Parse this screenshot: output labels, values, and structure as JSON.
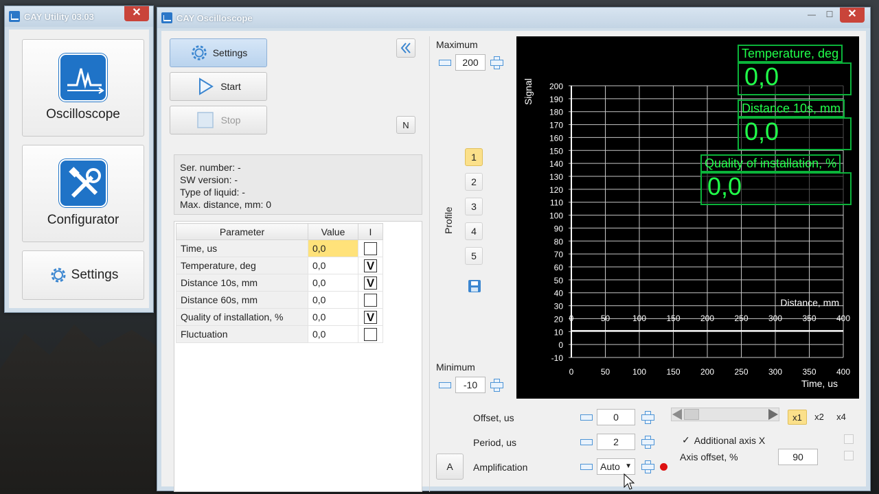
{
  "util_window": {
    "title": "CAY Utility 03.03",
    "close": "✕",
    "buttons": [
      {
        "label": "Oscilloscope",
        "icon": "oscilloscope-icon"
      },
      {
        "label": "Configurator",
        "icon": "tools-icon"
      },
      {
        "label": "Settings",
        "icon": "gear-icon"
      }
    ]
  },
  "osc_window": {
    "title": "CAY Oscilloscope",
    "controls": {
      "minimize": "—",
      "maximize": "☐",
      "close": "✕"
    },
    "settings_label": "Settings",
    "start_label": "Start",
    "stop_label": "Stop",
    "n_label": "N",
    "info": {
      "serial": "Ser. number: -",
      "sw": "SW version: -",
      "liquid": "Type of liquid: -",
      "maxdist": "Max. distance, mm: 0"
    },
    "table": {
      "headers": [
        "Parameter",
        "Value",
        "I"
      ],
      "rows": [
        {
          "name": "Time, us",
          "value": "0,0",
          "checked": false
        },
        {
          "name": "Temperature, deg",
          "value": "0,0",
          "checked": true
        },
        {
          "name": "Distance 10s, mm",
          "value": "0,0",
          "checked": true
        },
        {
          "name": "Distance 60s, mm",
          "value": "0,0",
          "checked": false
        },
        {
          "name": "Quality of installation, %",
          "value": "0,0",
          "checked": true
        },
        {
          "name": "Fluctuation",
          "value": "0,0",
          "checked": false
        }
      ],
      "check_mark": "V"
    },
    "maximum": {
      "label": "Maximum",
      "value": "200"
    },
    "minimum": {
      "label": "Minimum",
      "value": "-10"
    },
    "profile": {
      "label": "Profile",
      "items": [
        "1",
        "2",
        "3",
        "4",
        "5"
      ],
      "active": "1"
    },
    "scope": {
      "y_axis_label": "Signal",
      "y_ticks": [
        200,
        190,
        180,
        170,
        160,
        150,
        140,
        130,
        120,
        110,
        100,
        90,
        80,
        70,
        60,
        50,
        40,
        30,
        20,
        10,
        0,
        -10
      ],
      "x_ticks": [
        0,
        50,
        100,
        150,
        200,
        250,
        300,
        350,
        400
      ],
      "x_label": "Time, us",
      "x2_label": "Distance, mm",
      "readouts": [
        {
          "title": "Temperature, deg",
          "value": "0,0"
        },
        {
          "title": "Distance 10s, mm",
          "value": "0,0"
        },
        {
          "title": "Quality of installation, %",
          "value": "0,0"
        }
      ],
      "colors": {
        "background": "#000000",
        "grid": "#c8c8c8",
        "readout": "#20ff4a"
      }
    },
    "offset": {
      "label": "Offset, us",
      "value": "0"
    },
    "period": {
      "label": "Period, us",
      "value": "2"
    },
    "amplification": {
      "label": "Amplification",
      "value": "Auto"
    },
    "a_button": "A",
    "zoom": [
      "x1",
      "x2",
      "x4"
    ],
    "zoom_active": "x1",
    "additional_axis": {
      "label": "Additional axis X",
      "checked": true
    },
    "axis_offset": {
      "label": "Axis offset, %",
      "value": "90"
    }
  }
}
